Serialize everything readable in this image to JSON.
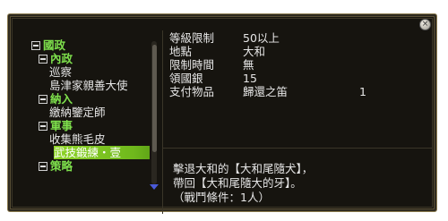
{
  "tree": {
    "items": [
      {
        "label": "國政",
        "type": "category",
        "expanded": true
      },
      {
        "label": "內政",
        "type": "category",
        "expanded": true
      },
      {
        "label": "巡察",
        "type": "task"
      },
      {
        "label": "島津家親善大使",
        "type": "task"
      },
      {
        "label": "納入",
        "type": "category",
        "expanded": true
      },
      {
        "label": "繳納鑒定師",
        "type": "task"
      },
      {
        "label": "軍事",
        "type": "category",
        "expanded": true
      },
      {
        "label": "收集熊毛皮",
        "type": "task"
      },
      {
        "label": "武技鍛練・壹",
        "type": "task",
        "selected": true
      },
      {
        "label": "策略",
        "type": "category",
        "expanded": true
      }
    ]
  },
  "details": {
    "rows": [
      {
        "key": "等級限制",
        "value": "50以上"
      },
      {
        "key": "地點",
        "value": "大和"
      },
      {
        "key": "限制時間",
        "value": "無"
      },
      {
        "key": "領國銀",
        "value": "15"
      },
      {
        "key": "支付物品",
        "value": "歸還之笛",
        "qty": "1"
      }
    ]
  },
  "description": {
    "lines": [
      "擊退大和的【大和尾隨犬】，",
      "帶回【大和尾隨大的牙】。",
      "（戰鬥條件：1人）"
    ]
  },
  "colors": {
    "category_text": "#7ee04c",
    "selection": "#8fd428",
    "text": "#e6e6e6",
    "background": "#16140f"
  },
  "icons": {
    "close": "×",
    "scroll_down": "blue-down-triangle"
  }
}
